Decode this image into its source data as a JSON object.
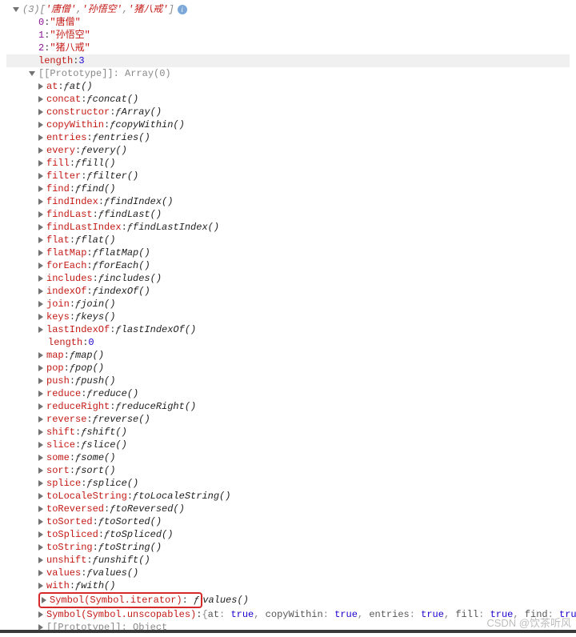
{
  "summary": {
    "count_prefix": "(3)",
    "preview_items": [
      "'唐僧'",
      "'孙悟空'",
      "'猪八戒'"
    ],
    "info_glyph": "i"
  },
  "array_items": [
    {
      "idx": "0",
      "val": "\"唐僧\""
    },
    {
      "idx": "1",
      "val": "\"孙悟空\""
    },
    {
      "idx": "2",
      "val": "\"猪八戒\""
    }
  ],
  "length_row": {
    "key": "length",
    "val": "3"
  },
  "proto_header": {
    "label": "[[Prototype]]",
    "after": ": Array(0)"
  },
  "proto_methods": [
    {
      "name": "at",
      "sig": "at()"
    },
    {
      "name": "concat",
      "sig": "concat()"
    },
    {
      "name": "constructor",
      "sig": "Array()"
    },
    {
      "name": "copyWithin",
      "sig": "copyWithin()"
    },
    {
      "name": "entries",
      "sig": "entries()"
    },
    {
      "name": "every",
      "sig": "every()"
    },
    {
      "name": "fill",
      "sig": "fill()"
    },
    {
      "name": "filter",
      "sig": "filter()"
    },
    {
      "name": "find",
      "sig": "find()"
    },
    {
      "name": "findIndex",
      "sig": "findIndex()"
    },
    {
      "name": "findLast",
      "sig": "findLast()"
    },
    {
      "name": "findLastIndex",
      "sig": "findLastIndex()"
    },
    {
      "name": "flat",
      "sig": "flat()"
    },
    {
      "name": "flatMap",
      "sig": "flatMap()"
    },
    {
      "name": "forEach",
      "sig": "forEach()"
    },
    {
      "name": "includes",
      "sig": "includes()"
    },
    {
      "name": "indexOf",
      "sig": "indexOf()"
    },
    {
      "name": "join",
      "sig": "join()"
    },
    {
      "name": "keys",
      "sig": "keys()"
    },
    {
      "name": "lastIndexOf",
      "sig": "lastIndexOf()"
    }
  ],
  "proto_length": {
    "key": "length",
    "val": "0"
  },
  "proto_methods2": [
    {
      "name": "map",
      "sig": "map()"
    },
    {
      "name": "pop",
      "sig": "pop()"
    },
    {
      "name": "push",
      "sig": "push()"
    },
    {
      "name": "reduce",
      "sig": "reduce()"
    },
    {
      "name": "reduceRight",
      "sig": "reduceRight()"
    },
    {
      "name": "reverse",
      "sig": "reverse()"
    },
    {
      "name": "shift",
      "sig": "shift()"
    },
    {
      "name": "slice",
      "sig": "slice()"
    },
    {
      "name": "some",
      "sig": "some()"
    },
    {
      "name": "sort",
      "sig": "sort()"
    },
    {
      "name": "splice",
      "sig": "splice()"
    },
    {
      "name": "toLocaleString",
      "sig": "toLocaleString()"
    },
    {
      "name": "toReversed",
      "sig": "toReversed()"
    },
    {
      "name": "toSorted",
      "sig": "toSorted()"
    },
    {
      "name": "toSpliced",
      "sig": "toSpliced()"
    },
    {
      "name": "toString",
      "sig": "toString()"
    },
    {
      "name": "unshift",
      "sig": "unshift()"
    },
    {
      "name": "values",
      "sig": "values()"
    },
    {
      "name": "with",
      "sig": "with()"
    }
  ],
  "symbol_iter": {
    "key": "Symbol(Symbol.iterator)",
    "f": "ƒ",
    "sig": "values()"
  },
  "symbol_unscope": {
    "key": "Symbol(Symbol.unscopables)",
    "preview": "{at: true, copyWithin: true, entries: true, fill: true, find: true, …}"
  },
  "proto_proto": {
    "label": "[[Prototype]]",
    "after": ": Object"
  },
  "f_glyph": "ƒ",
  "watermark": "CSDN @饮茶听风"
}
